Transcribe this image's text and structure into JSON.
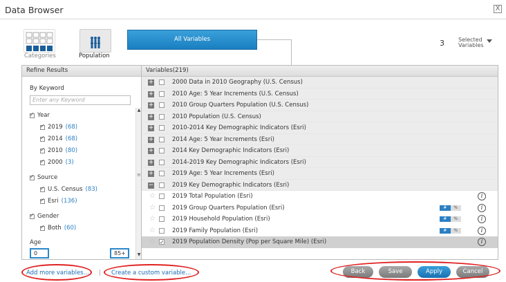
{
  "window": {
    "title": "Data Browser",
    "close_label": "X"
  },
  "tabs": {
    "categories_label": "Categories",
    "population_label": "Population",
    "all_variables_label": "All Variables"
  },
  "selected": {
    "count": "3",
    "label_line1": "Selected",
    "label_line2": "Variables"
  },
  "refine": {
    "header": "Refine Results",
    "keyword_label": "By Keyword",
    "keyword_placeholder": "Enter any Keyword",
    "filters": {
      "year_label": "Year",
      "y2019": "2019",
      "y2019_count": "(68)",
      "y2014": "2014",
      "y2014_count": "(68)",
      "y2010": "2010",
      "y2010_count": "(80)",
      "y2000": "2000",
      "y2000_count": "(3)",
      "source_label": "Source",
      "census": "U.S. Census",
      "census_count": "(83)",
      "esri": "Esri",
      "esri_count": "(136)",
      "gender_label": "Gender",
      "both": "Both",
      "both_count": "(60)",
      "age_label": "Age",
      "age_min": "0",
      "age_max": "85+"
    }
  },
  "variables": {
    "header": "Variables(219)",
    "groups": [
      "2000 Data in 2010 Geography (U.S. Census)",
      "2010 Age: 5 Year Increments (U.S. Census)",
      "2010 Group Quarters Population (U.S. Census)",
      "2010 Population (U.S. Census)",
      "2010-2014 Key Demographic Indicators (Esri)",
      "2014 Age: 5 Year Increments (Esri)",
      "2014 Key Demographic Indicators (Esri)",
      "2014-2019 Key Demographic Indicators (Esri)",
      "2019 Age: 5 Year Increments (Esri)",
      "2019 Key Demographic Indicators (Esri)"
    ],
    "items": [
      "2019 Total Population (Esri)",
      "2019 Group Quarters Population (Esri)",
      "2019 Household Population (Esri)",
      "2019 Family Population (Esri)",
      "2019 Population Density (Pop per Square Mile) (Esri)"
    ],
    "pill_left": "#",
    "pill_right": "%",
    "info": "i"
  },
  "footer": {
    "add_more": "Add more variables...",
    "separator": "|",
    "create_custom": "Create a custom variable...",
    "back": "Back",
    "save": "Save",
    "apply": "Apply",
    "cancel": "Cancel"
  },
  "colors": {
    "accent": "#2a7fc4",
    "highlight": "#e02020"
  }
}
